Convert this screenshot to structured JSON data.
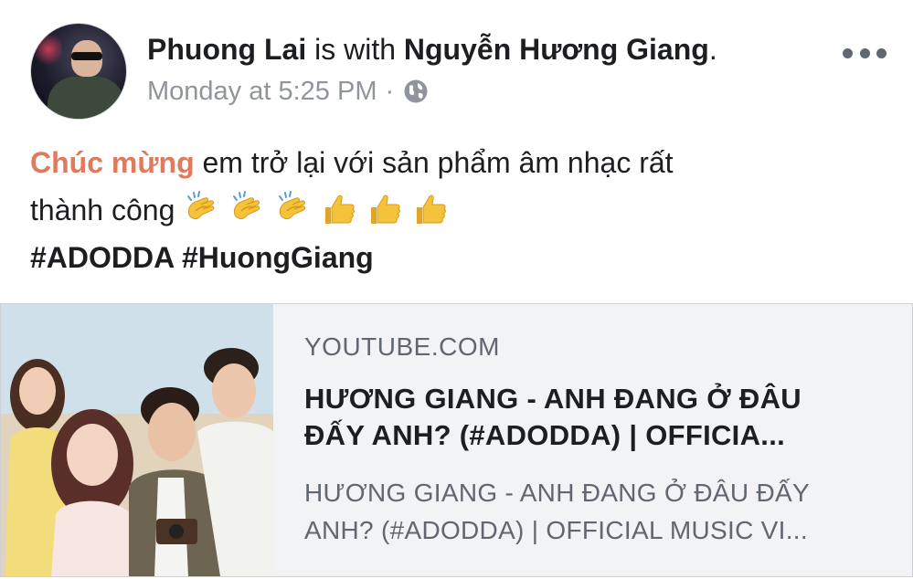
{
  "post": {
    "author": "Phuong Lai",
    "with_text": "is with",
    "tagged": "Nguyễn Hương Giang",
    "period": ".",
    "timestamp": "Monday at 5:25 PM",
    "separator": "·",
    "privacy_icon": "globe-icon",
    "more_icon": "more-options-icon",
    "avatar_icon": "profile-photo",
    "message": {
      "link_text": "Chúc mừng",
      "line1_rest": " em trở lại với sản phẩm âm nhạc rất",
      "line2_text": "thành công ",
      "emojis": [
        "clapping-hands-emoji",
        "clapping-hands-emoji",
        "clapping-hands-emoji",
        "thumbs-up-emoji",
        "thumbs-up-emoji",
        "thumbs-up-emoji"
      ],
      "hashtags": "#ADODDA #HuongGiang"
    }
  },
  "link_preview": {
    "domain": "YOUTUBE.COM",
    "title_line1": "HƯƠNG GIANG - ANH ĐANG Ở ĐÂU",
    "title_line2": "ĐẤY ANH? (#ADODDA) | OFFICIA...",
    "desc_line1": "HƯƠNG GIANG - ANH ĐANG Ở ĐÂU ĐẤY",
    "desc_line2": "ANH? (#ADODDA) | OFFICIAL MUSIC VI...",
    "thumbnail": "music-video-thumbnail"
  },
  "colors": {
    "link": "#e07a5f",
    "meta": "#90949c",
    "card_bg": "#f2f3f5"
  }
}
